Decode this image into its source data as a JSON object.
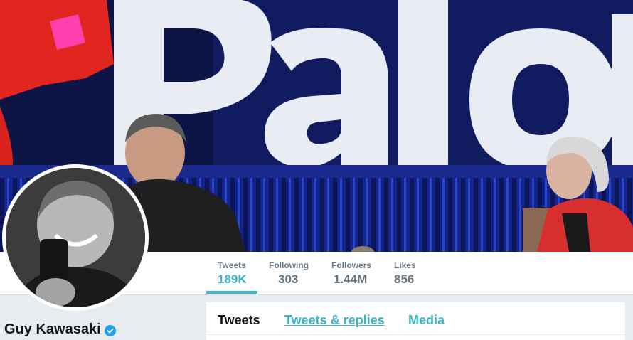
{
  "profile": {
    "name": "Guy Kawasaki",
    "verified": true,
    "verified_icon": "verified-badge-icon",
    "avatar_icon": "profile-photo"
  },
  "colors": {
    "accent": "#3bb4c4",
    "stat_text": "#657786",
    "verified_blue": "#1da1f2"
  },
  "nav": {
    "stats": [
      {
        "label": "Tweets",
        "value": "189K",
        "active": true
      },
      {
        "label": "Following",
        "value": "303",
        "active": false
      },
      {
        "label": "Followers",
        "value": "1.44M",
        "active": false
      },
      {
        "label": "Likes",
        "value": "856",
        "active": false
      }
    ]
  },
  "timeline": {
    "tabs": [
      {
        "label": "Tweets",
        "current": true
      },
      {
        "label": "Tweets & replies",
        "current": false
      },
      {
        "label": "Media",
        "current": false
      }
    ]
  }
}
